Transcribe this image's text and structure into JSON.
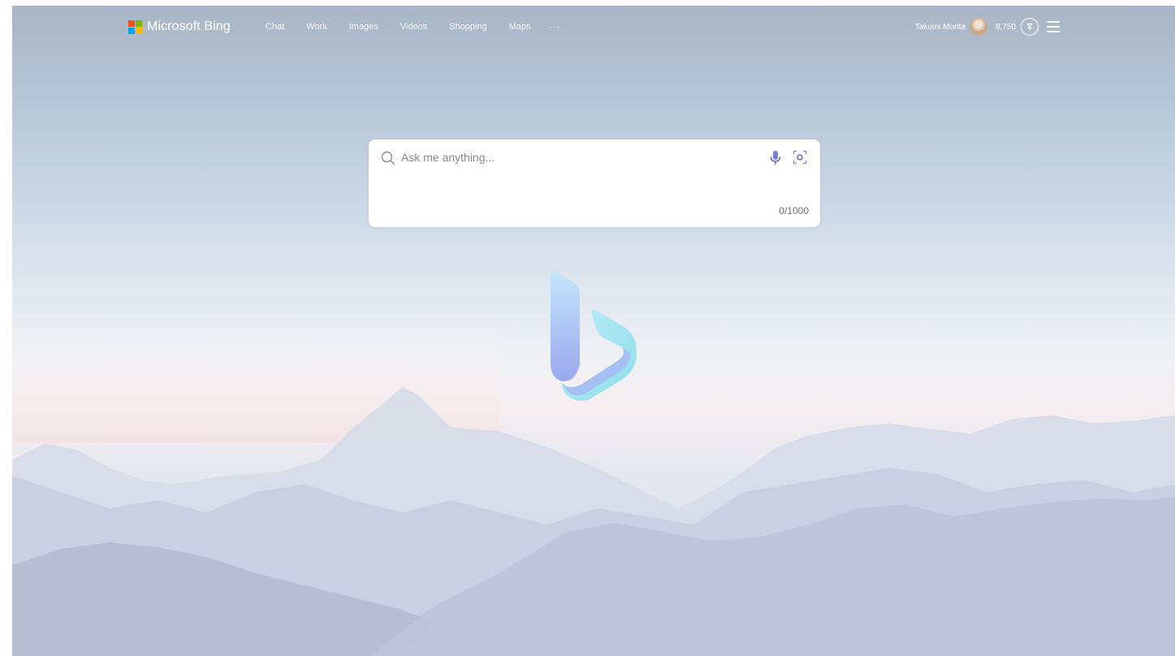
{
  "brand": {
    "name": "Microsoft Bing",
    "logo_colors": [
      "#f25022",
      "#7fba00",
      "#00a4ef",
      "#ffb900"
    ]
  },
  "nav": {
    "items": [
      {
        "label": "Chat"
      },
      {
        "label": "Work"
      },
      {
        "label": "Images"
      },
      {
        "label": "Videos"
      },
      {
        "label": "Shopping"
      },
      {
        "label": "Maps"
      }
    ],
    "more_label": "···"
  },
  "account": {
    "user_name": "Takumi Morita",
    "points": "8,750"
  },
  "search": {
    "placeholder": "Ask me anything...",
    "value": "",
    "counter": "0/1000"
  },
  "icons": {
    "search": "search-icon",
    "mic": "microphone-icon",
    "visual_search": "visual-search-icon",
    "rewards": "rewards-icon",
    "menu": "hamburger-menu-icon",
    "bing_logo": "bing-logo-icon"
  }
}
